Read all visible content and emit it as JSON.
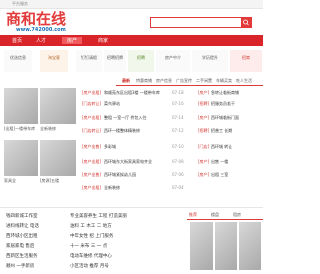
{
  "topbar": {
    "text": "平台服务"
  },
  "logo": {
    "main": "商和在线",
    "sub": "www.742000.com"
  },
  "nav": {
    "items": [
      "首页",
      "人才",
      "房产",
      "商家"
    ]
  },
  "promos": [
    {
      "label": "优选信息"
    },
    {
      "label": "淘宝客"
    },
    {
      "label": "钉钉请假"
    },
    {
      "label": "招聘招牌"
    },
    {
      "label": "招聘"
    },
    {
      "label": "房产中介"
    },
    {
      "label": "学历提升"
    },
    {
      "label": "招商"
    }
  ],
  "tabs": [
    "最新",
    "特惠商铺",
    "房产信息",
    "广告宣传",
    "二手闲置",
    "车辆买卖",
    "吃人生活"
  ],
  "photo_caption_1": "[出租]一楼带车库",
  "photo_caption_2": "全新装修",
  "photo_caption_3": "家具全",
  "photo_caption_4": "[房源]五楼",
  "rows": [
    {
      "tag": "[房产出租]",
      "text": "和顺苑东区出租3楼 一楼带车库",
      "date": "07-18"
    },
    {
      "tag": "[门店转让]",
      "text": "菜鸟驿站",
      "date": "07-16"
    },
    {
      "tag": "[房产出租]",
      "text": "整租 一室一厅 拎包入住",
      "date": "07-14"
    },
    {
      "tag": "[门店转让]",
      "text": "西环一楼整体精装修",
      "date": "07-12"
    },
    {
      "tag": "[房产出售]",
      "text": "多彩城",
      "date": "07-10"
    },
    {
      "tag": "[房产出租]",
      "text": "西环城东大街家具家电齐全",
      "date": "07-08"
    },
    {
      "tag": "[房产出售]",
      "text": "西环城紧挨幼儿园",
      "date": "07-06"
    },
    {
      "tag": "[房产出租]",
      "text": "全新装修",
      "date": "07-04"
    }
  ],
  "right_rows": [
    {
      "tag": "[房产]",
      "text": "急转让临街商铺"
    },
    {
      "tag": "[招聘]",
      "text": "招服务员若干"
    },
    {
      "tag": "[房产]",
      "text": "西环城临街门面"
    },
    {
      "tag": "[招聘]",
      "text": "招普工 长期"
    },
    {
      "tag": "[门店]",
      "text": "西环城 转让"
    },
    {
      "tag": "[房产]",
      "text": "出售 一楼"
    },
    {
      "tag": "[房产]",
      "text": "出租 三室"
    }
  ],
  "bottom_left": [
    "钱四新城工作室",
    "进料线转让 电话",
    "西环城小区出租",
    "家居家电 售后",
    "西新区生活服务",
    "顺州 一手新房",
    "售房 电话咨询"
  ],
  "bottom_mid": [
    "专业美容养生 工程 打造美丽",
    "油料 工 木工 二 地方",
    "中年女性 招 上门服务",
    "十一 米布 三 一 点",
    "电动车维修 代理中心",
    "小区活动 推荐 月号",
    "小学生辅导 托管 中心"
  ],
  "right_tabs": [
    "推荐",
    "楼盘",
    "租房"
  ]
}
